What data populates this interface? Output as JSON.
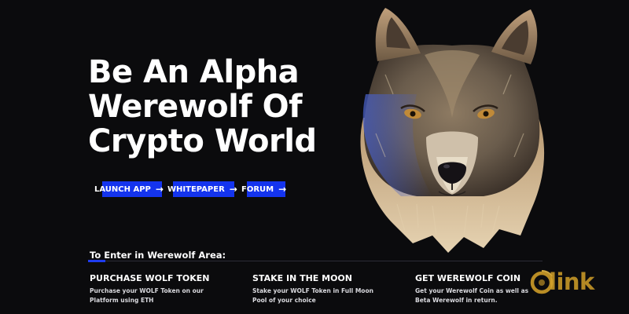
{
  "hero": {
    "title_lines": [
      "Be An Alpha",
      "Werewolf Of",
      "Crypto World"
    ]
  },
  "buttons": {
    "launch_app": "LAUNCH APP",
    "whitepaper": "WHITEPAPER",
    "forum": "FORUM",
    "arrow": "→"
  },
  "section": {
    "heading": "To Enter in Werewolf Area:"
  },
  "features": [
    {
      "title": "PURCHASE WOLF TOKEN",
      "description": "Purchase your WOLF Token on our Platform using ETH"
    },
    {
      "title": "STAKE IN THE MOON",
      "description": "Stake your WOLF Token in Full Moon Pool of your choice"
    },
    {
      "title": "GET WEREWOLF COIN",
      "description": "Get your Werewolf Coin as well as Beta Werewolf in return."
    }
  ],
  "watermark": {
    "text": "link"
  },
  "colors": {
    "background": "#0b0b0d",
    "accent": "#1434ee",
    "watermark": "#d8a52a",
    "text": "#ffffff"
  },
  "icons": {
    "button_arrow": "arrow-right-icon",
    "wolf": "wolf-head-illustration",
    "watermark_logo": "olink-logo"
  }
}
